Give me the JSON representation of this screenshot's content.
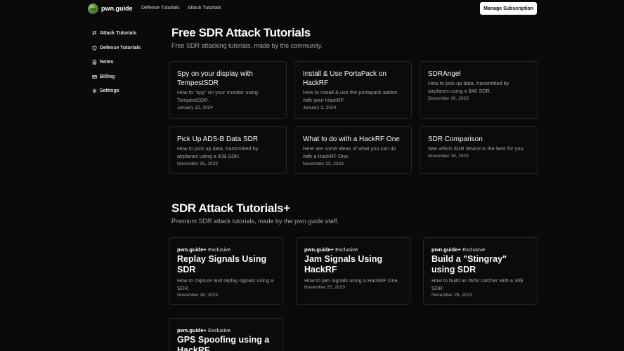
{
  "nav": {
    "brand": "pwn.guide",
    "links": [
      "Defense Tutorials",
      "Attack Tutorials"
    ],
    "manage_label": "Manage Subscription"
  },
  "sidebar": {
    "items": [
      {
        "label": "Attack Tutorials",
        "icon": "flag-icon"
      },
      {
        "label": "Defense Tutorials",
        "icon": "shield-icon"
      },
      {
        "label": "Notes",
        "icon": "notes-icon"
      },
      {
        "label": "Billing",
        "icon": "credit-card-icon"
      },
      {
        "label": "Settings",
        "icon": "gear-icon"
      }
    ]
  },
  "free": {
    "title": "Free SDR Attack Tutorials",
    "subtitle": "Free SDR attacking tutorials, made by the community.",
    "cards": [
      {
        "title": "Spy on your display with TempestSDR",
        "desc": "How to \"spy\" on your monitor using TempestSDR.",
        "date": "January 22, 2024"
      },
      {
        "title": "Install & Use PortaPack on HackRF",
        "desc": "How to install & use the portapack addon with your HackRF.",
        "date": "January 3, 2024"
      },
      {
        "title": "SDRAngel",
        "desc": "How to pick up data, transmitted by airplanes using a $40 SDR.",
        "date": "December 26, 2023"
      },
      {
        "title": "Pick Up ADS-B Data SDR",
        "desc": "How to pick up data, transmitted by airplanes using a 40$ SDR.",
        "date": "November 26, 2023"
      },
      {
        "title": "What to do with a HackRF One",
        "desc": "Here are some ideas of what you can do with a HackRF One.",
        "date": "November 23, 2023"
      },
      {
        "title": "SDR Comparison",
        "desc": "See which SDR device is the best for you.",
        "date": "November 19, 2023"
      }
    ]
  },
  "premium": {
    "title": "SDR Attack Tutorials+",
    "subtitle": "Premium SDR attack tutorials, made by the pwn.guide staff.",
    "badge_brand": "pwn.guide+",
    "badge_text": "Exclusive",
    "cards": [
      {
        "title": "Replay Signals Using SDR",
        "desc": "How to capture and replay signals using a SDR.",
        "date": "November 26, 2023"
      },
      {
        "title": "Jam Signals Using HackRF",
        "desc": "How to jam signals using a HackRF One.",
        "date": "November 25, 2023"
      },
      {
        "title": "Build a \"Stingray\" using SDR",
        "desc": "How to build an IMSI catcher with a 30$ SDR.",
        "date": "November 25, 2023"
      },
      {
        "title": "GPS Spoofing using a HackRF",
        "desc": "",
        "date": ""
      }
    ]
  }
}
